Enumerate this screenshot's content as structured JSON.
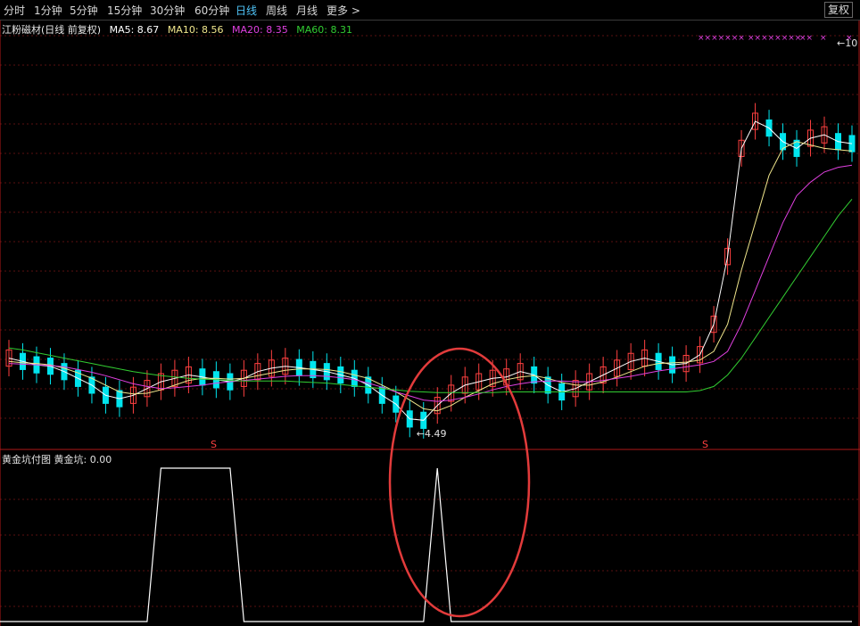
{
  "toolbar": {
    "items": [
      "分时",
      "1分钟",
      "5分钟",
      "15分钟",
      "30分钟",
      "60分钟",
      "日线",
      "周线",
      "月线",
      "更多 >"
    ],
    "active": "日线",
    "fuquan": "复权"
  },
  "main_legend": {
    "title": "江粉磁材(日线 前复权)",
    "ma": [
      {
        "label": "MA5: 8.67",
        "color": "#ffffff"
      },
      {
        "label": "MA10: 8.56",
        "color": "#f0e68c"
      },
      {
        "label": "MA20: 8.35",
        "color": "#e040e0"
      },
      {
        "label": "MA60: 8.31",
        "color": "#32cd32"
      }
    ]
  },
  "sub_legend": {
    "title": "黄金坑付图",
    "value_label": "黄金坑: 0.00"
  },
  "annotations": {
    "low_label": "←4.49",
    "high_label": "←10",
    "s_marker": "S",
    "x_markers": [
      "×××××××",
      "××××××××",
      "××",
      "×",
      "×"
    ]
  },
  "colors": {
    "up": "#ff4040",
    "down": "#00e5ee",
    "ma5": "#ffffff",
    "ma10": "#f0e68c",
    "ma20": "#e040e0",
    "ma60": "#32cd32",
    "ellipse": "#e23b3b",
    "grid": "#5a1010",
    "separator": "#b01818"
  },
  "chart_data": [
    {
      "type": "line",
      "title": "江粉磁材(日线 前复权)",
      "series": [
        {
          "name": "MA5",
          "values": [
            5.5,
            5.45,
            5.4,
            5.38,
            5.3,
            5.2,
            5.1,
            4.95,
            4.9,
            4.95,
            5.05,
            5.15,
            5.2,
            5.25,
            5.22,
            5.18,
            5.15,
            5.2,
            5.3,
            5.35,
            5.38,
            5.36,
            5.33,
            5.3,
            5.25,
            5.2,
            5.1,
            4.95,
            4.82,
            4.6,
            4.58,
            4.8,
            4.98,
            5.1,
            5.15,
            5.2,
            5.22,
            5.3,
            5.25,
            5.1,
            5.0,
            5.05,
            5.15,
            5.25,
            5.35,
            5.45,
            5.5,
            5.45,
            5.4,
            5.42,
            5.55,
            6.0,
            7.0,
            8.6,
            9.0,
            8.9,
            8.7,
            8.6,
            8.75,
            8.8,
            8.7,
            8.67
          ]
        },
        {
          "name": "MA10",
          "values": [
            5.45,
            5.43,
            5.42,
            5.4,
            5.35,
            5.28,
            5.2,
            5.1,
            5.0,
            4.97,
            4.98,
            5.03,
            5.1,
            5.17,
            5.2,
            5.2,
            5.19,
            5.2,
            5.24,
            5.28,
            5.32,
            5.34,
            5.34,
            5.33,
            5.3,
            5.25,
            5.2,
            5.1,
            5.0,
            4.88,
            4.75,
            4.72,
            4.8,
            4.92,
            5.02,
            5.12,
            5.18,
            5.22,
            5.24,
            5.2,
            5.14,
            5.1,
            5.1,
            5.15,
            5.22,
            5.3,
            5.38,
            5.42,
            5.43,
            5.44,
            5.47,
            5.6,
            6.0,
            6.8,
            7.5,
            8.2,
            8.6,
            8.7,
            8.65,
            8.6,
            8.58,
            8.56
          ]
        },
        {
          "name": "MA20",
          "values": [
            5.42,
            5.41,
            5.4,
            5.39,
            5.37,
            5.33,
            5.29,
            5.24,
            5.18,
            5.12,
            5.08,
            5.05,
            5.06,
            5.08,
            5.1,
            5.13,
            5.15,
            5.17,
            5.19,
            5.21,
            5.23,
            5.24,
            5.24,
            5.23,
            5.21,
            5.18,
            5.13,
            5.07,
            5.0,
            4.94,
            4.88,
            4.86,
            4.88,
            4.92,
            4.97,
            5.03,
            5.08,
            5.12,
            5.15,
            5.16,
            5.16,
            5.15,
            5.15,
            5.17,
            5.2,
            5.23,
            5.27,
            5.31,
            5.34,
            5.37,
            5.4,
            5.45,
            5.6,
            6.0,
            6.5,
            7.0,
            7.5,
            7.9,
            8.1,
            8.25,
            8.32,
            8.35
          ]
        },
        {
          "name": "MA60",
          "values": [
            5.65,
            5.62,
            5.58,
            5.54,
            5.5,
            5.46,
            5.42,
            5.38,
            5.34,
            5.3,
            5.27,
            5.24,
            5.22,
            5.2,
            5.19,
            5.18,
            5.17,
            5.16,
            5.16,
            5.16,
            5.16,
            5.15,
            5.14,
            5.13,
            5.11,
            5.09,
            5.07,
            5.05,
            5.03,
            5.01,
            5.0,
            4.99,
            4.99,
            4.99,
            4.99,
            4.99,
            5.0,
            5.0,
            5.0,
            5.0,
            5.0,
            5.0,
            5.0,
            5.0,
            5.0,
            5.0,
            5.0,
            5.0,
            5.0,
            5.0,
            5.02,
            5.08,
            5.25,
            5.5,
            5.8,
            6.1,
            6.4,
            6.7,
            7.0,
            7.3,
            7.6,
            7.85
          ]
        }
      ],
      "y_min_label": 4.49,
      "y_max_label": 10
    },
    {
      "type": "line",
      "title": "黄金坑付图",
      "series": [
        {
          "name": "黄金坑",
          "values": [
            0,
            0,
            0,
            0,
            0,
            0,
            0,
            0,
            0,
            0,
            0,
            1,
            1,
            1,
            1,
            1,
            1,
            0,
            0,
            0,
            0,
            0,
            0,
            0,
            0,
            0,
            0,
            0,
            0,
            0,
            0,
            1,
            0,
            0,
            0,
            0,
            0,
            0,
            0,
            0,
            0,
            0,
            0,
            0,
            0,
            0,
            0,
            0,
            0,
            0,
            0,
            0,
            0,
            0,
            0,
            0,
            0,
            0,
            0,
            0,
            0,
            0
          ]
        }
      ],
      "ylim": [
        0,
        1
      ]
    }
  ]
}
